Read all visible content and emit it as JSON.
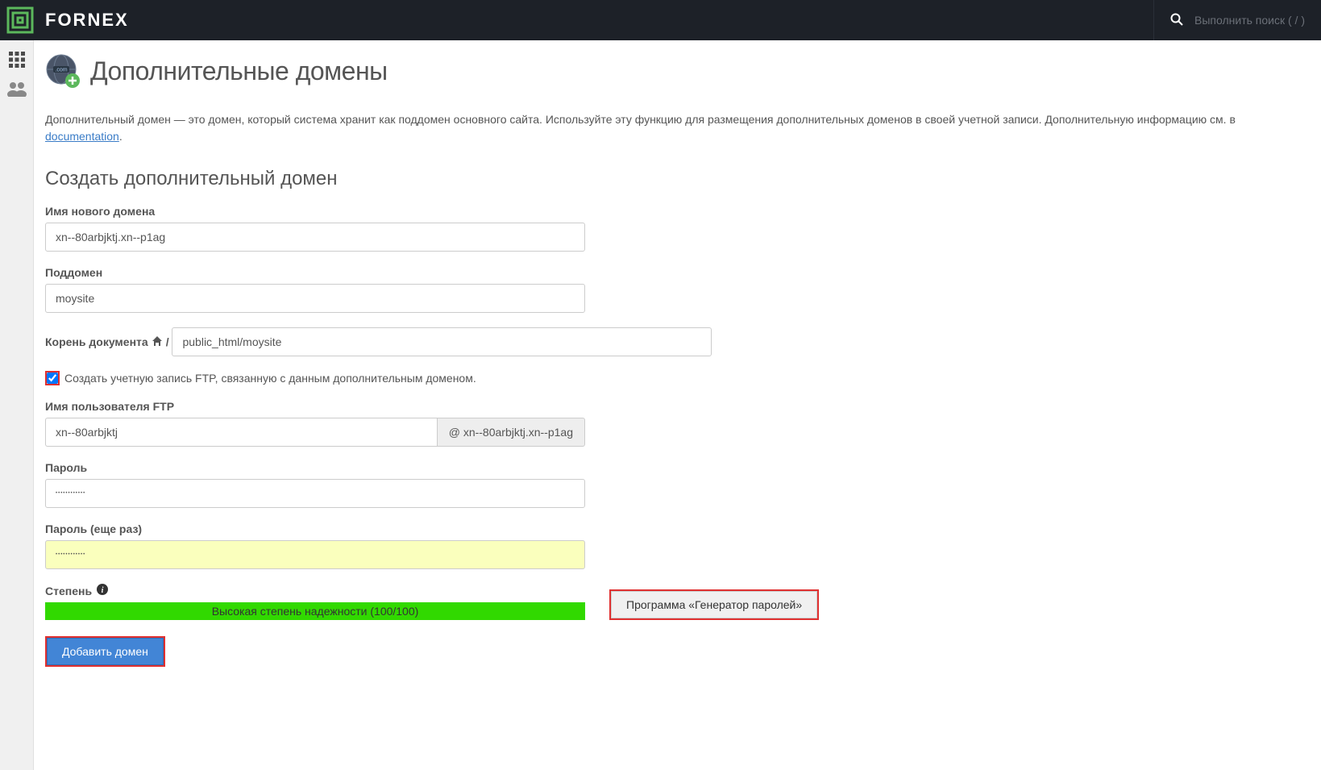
{
  "header": {
    "brand": "FORNEX",
    "search_placeholder": "Выполнить поиск ( / )"
  },
  "page": {
    "title": "Дополнительные домены",
    "intro_before": "Дополнительный домен — это домен, который система хранит как поддомен основного сайта. Используйте эту функцию для размещения дополнительных доменов в своей учетной записи. Дополнительную информацию см. в ",
    "doc_link": "documentation",
    "intro_after": ".",
    "section_heading": "Создать дополнительный домен"
  },
  "form": {
    "new_domain_label": "Имя нового домена",
    "new_domain_value": "xn--80arbjktj.xn--p1ag",
    "subdomain_label": "Поддомен",
    "subdomain_value": "moysite",
    "docroot_label": "Корень документа",
    "docroot_suffix": "/",
    "docroot_value": "public_html/moysite",
    "ftp_checkbox_label": "Создать учетную запись FTP, связанную с данным дополнительным доменом.",
    "ftp_user_label": "Имя пользователя FTP",
    "ftp_user_value": "xn--80arbjktj",
    "ftp_user_addon": "@ xn--80arbjktj.xn--p1ag",
    "password_label": "Пароль",
    "password_value": "••••••••••••",
    "password2_label": "Пароль (еще раз)",
    "password2_value": "••••••••••••",
    "strength_label": "Степень",
    "strength_text": "Высокая степень надежности (100/100)",
    "gen_button": "Программа «Генератор паролей»",
    "submit_button": "Добавить домен"
  }
}
